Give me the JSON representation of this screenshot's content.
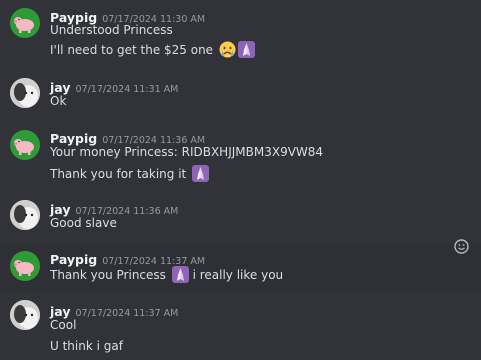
{
  "messages": [
    {
      "username": "Paypig",
      "timestamp": "07/17/2024 11:30 AM",
      "avatar_icon": "pig-avatar-icon",
      "lines": [
        {
          "text": "Understood Princess"
        },
        {
          "text": "I'll need to get the $25 one",
          "emojis": [
            "crying-face-icon",
            "praying-hands-icon"
          ]
        }
      ]
    },
    {
      "username": "jay",
      "timestamp": "07/17/2024 11:31 AM",
      "avatar_icon": "cat-avatar-icon",
      "lines": [
        {
          "text": "Ok"
        }
      ]
    },
    {
      "username": "Paypig",
      "timestamp": "07/17/2024 11:36 AM",
      "avatar_icon": "pig-avatar-icon",
      "lines": [
        {
          "text": "Your money Princess: RIDBXHJJMBM3X9VW84"
        },
        {
          "text": "Thank you for taking it",
          "emojis": [
            "praying-hands-icon"
          ]
        }
      ]
    },
    {
      "username": "jay",
      "timestamp": "07/17/2024 11:36 AM",
      "avatar_icon": "cat-avatar-icon",
      "lines": [
        {
          "text": "Good slave"
        }
      ]
    },
    {
      "username": "Paypig",
      "timestamp": "07/17/2024 11:37 AM",
      "avatar_icon": "pig-avatar-icon",
      "hovered": true,
      "lines": [
        {
          "text": "Thank you Princess",
          "emojis": [
            "praying-hands-icon"
          ],
          "text_after": "i really like you"
        }
      ]
    },
    {
      "username": "jay",
      "timestamp": "07/17/2024 11:37 AM",
      "avatar_icon": "cat-avatar-icon",
      "lines": [
        {
          "text": "Cool"
        },
        {
          "text": "U think i gaf"
        }
      ]
    }
  ],
  "reaction_button_icon": "add-reaction-icon",
  "colors": {
    "background": "#313338",
    "hover_background": "#2e3035",
    "username": "#f2f3f5",
    "timestamp": "#949ba4",
    "message_text": "#dbdee1",
    "pig_avatar_bg": "#2f9b37",
    "prayer_emoji_bg": "#8e63b8"
  }
}
